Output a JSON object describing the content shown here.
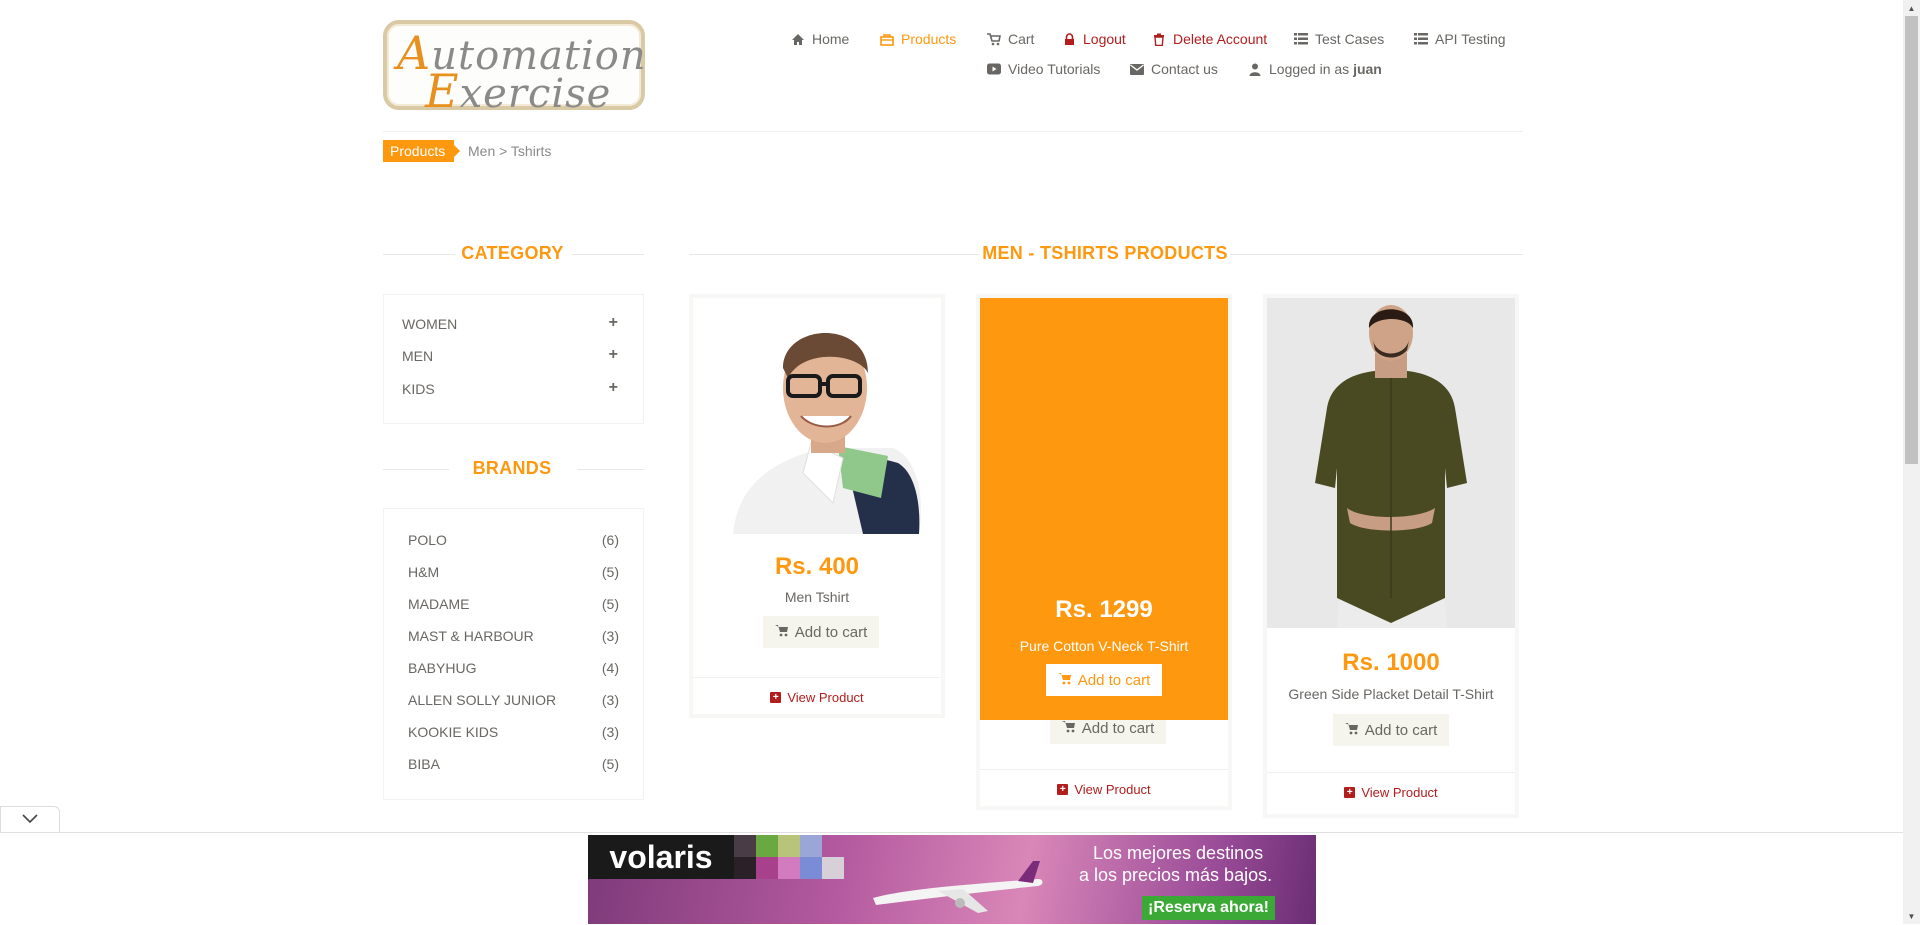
{
  "header": {
    "logo": {
      "line1_cap": "A",
      "line1_rest": "utomation",
      "line2_cap": "E",
      "line2_rest": "xercise"
    },
    "nav": {
      "home": "Home",
      "products": "Products",
      "cart": "Cart",
      "logout": "Logout",
      "delete_account": "Delete Account",
      "test_cases": "Test Cases",
      "api_testing": "API Testing",
      "video_tutorials": "Video Tutorials",
      "contact_us": "Contact us",
      "logged_in_prefix": "Logged in as",
      "username": "juan"
    }
  },
  "breadcrumb": {
    "tag": "Products",
    "path": "Men > Tshirts"
  },
  "sidebar": {
    "category_title": "CATEGORY",
    "categories": [
      {
        "label": "WOMEN",
        "icon": "plus-icon"
      },
      {
        "label": "MEN",
        "icon": "plus-icon"
      },
      {
        "label": "KIDS",
        "icon": "plus-icon"
      }
    ],
    "brands_title": "BRANDS",
    "brands": [
      {
        "name": "POLO",
        "count": "(6)"
      },
      {
        "name": "H&M",
        "count": "(5)"
      },
      {
        "name": "MADAME",
        "count": "(5)"
      },
      {
        "name": "MAST & HARBOUR",
        "count": "(3)"
      },
      {
        "name": "BABYHUG",
        "count": "(4)"
      },
      {
        "name": "ALLEN SOLLY JUNIOR",
        "count": "(3)"
      },
      {
        "name": "KOOKIE KIDS",
        "count": "(3)"
      },
      {
        "name": "BIBA",
        "count": "(5)"
      }
    ]
  },
  "main": {
    "title": "MEN - TSHIRTS PRODUCTS",
    "products": [
      {
        "price": "Rs. 400",
        "name": "Men Tshirt",
        "add_to_cart": "Add to cart",
        "view": "View Product"
      },
      {
        "price": "Rs. 1299",
        "name": "Pure Cotton V-Neck T-Shirt",
        "add_to_cart": "Add to cart",
        "view": "View Product"
      },
      {
        "price": "Rs. 1000",
        "name": "Green Side Placket Detail T-Shirt",
        "add_to_cart": "Add to cart",
        "view": "View Product"
      }
    ]
  },
  "ad": {
    "brand": "volaris",
    "tagline1": "Los mejores destinos",
    "tagline2": "a los precios más bajos.",
    "cta": "¡Reserva ahora!"
  },
  "colors": {
    "accent": "#fe980f",
    "danger": "#b21d1d",
    "text": "#696763"
  }
}
